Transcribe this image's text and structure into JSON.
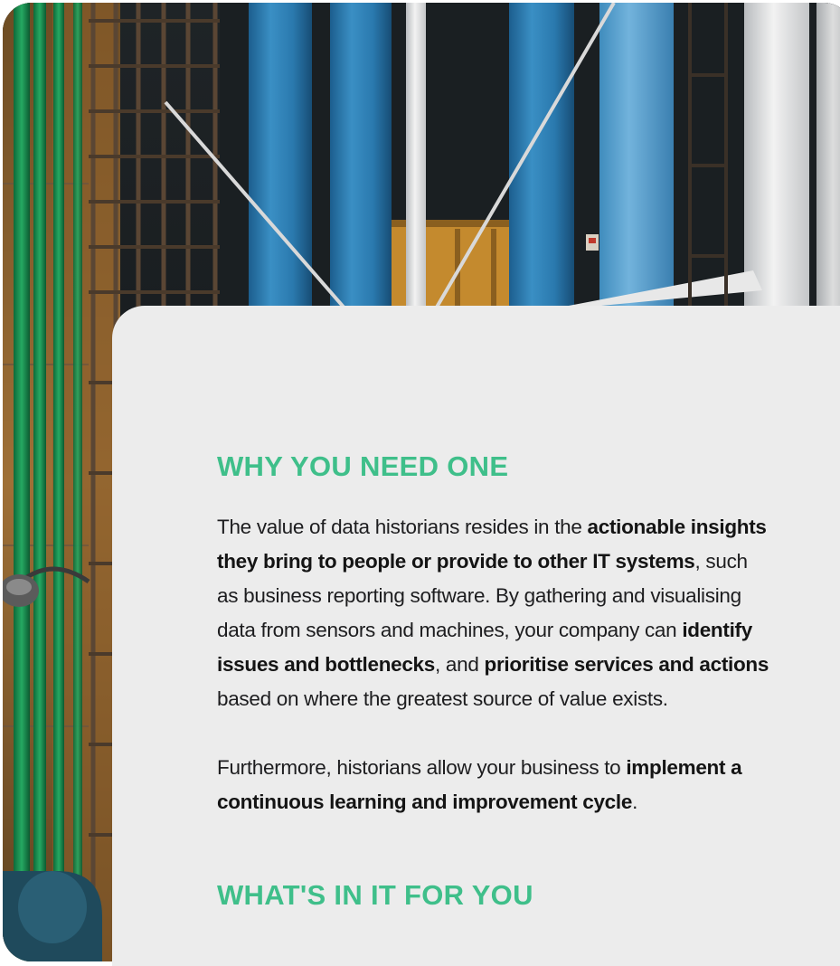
{
  "sections": [
    {
      "heading": "WHY YOU NEED ONE",
      "paragraphs": [
        {
          "lines": [
            [
              {
                "text": "The value of data historians resides in the ",
                "bold": false
              },
              {
                "text": "actionable insights",
                "bold": true
              }
            ],
            [
              {
                "text": "they bring to people or provide to other IT systems",
                "bold": true
              },
              {
                "text": ", such",
                "bold": false
              }
            ],
            [
              {
                "text": "as business reporting software. By gathering and visualising",
                "bold": false
              }
            ],
            [
              {
                "text": "data from sensors and machines, your company can ",
                "bold": false
              },
              {
                "text": "identify",
                "bold": true
              }
            ],
            [
              {
                "text": "issues and bottlenecks",
                "bold": true
              },
              {
                "text": ", and ",
                "bold": false
              },
              {
                "text": "prioritise services and actions",
                "bold": true
              }
            ],
            [
              {
                "text": "based on where the greatest source of value exists.",
                "bold": false
              }
            ]
          ]
        },
        {
          "lines": [
            [
              {
                "text": "Furthermore, historians allow your business to ",
                "bold": false
              },
              {
                "text": "implement a",
                "bold": true
              }
            ],
            [
              {
                "text": "continuous learning and improvement cycle",
                "bold": true
              },
              {
                "text": ".",
                "bold": false
              }
            ]
          ]
        }
      ]
    },
    {
      "heading": "WHAT'S IN IT FOR YOU",
      "paragraphs": []
    }
  ],
  "colors": {
    "heading_accent": "#3fbf8a",
    "card_background": "#ececec",
    "body_text": "#1d1d1f"
  },
  "hero_image": {
    "icon": "industrial-pipes-photo"
  }
}
